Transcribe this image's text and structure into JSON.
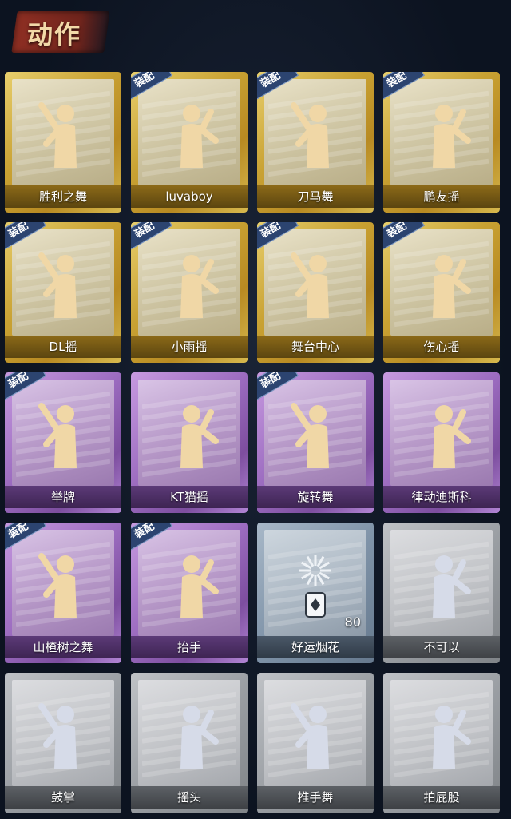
{
  "header": {
    "title": "动作"
  },
  "equipped_tag": "装配",
  "cards": [
    {
      "label": "胜利之舞",
      "rarity": "gold",
      "equipped": false
    },
    {
      "label": "luvaboy",
      "rarity": "gold",
      "equipped": true
    },
    {
      "label": "刀马舞",
      "rarity": "gold",
      "equipped": true
    },
    {
      "label": "鹏友摇",
      "rarity": "gold",
      "equipped": true
    },
    {
      "label": "DL摇",
      "rarity": "gold",
      "equipped": true
    },
    {
      "label": "小雨摇",
      "rarity": "gold",
      "equipped": true
    },
    {
      "label": "舞台中心",
      "rarity": "gold",
      "equipped": true
    },
    {
      "label": "伤心摇",
      "rarity": "gold",
      "equipped": true
    },
    {
      "label": "举牌",
      "rarity": "purple",
      "equipped": true
    },
    {
      "label": "KT猫摇",
      "rarity": "purple",
      "equipped": false
    },
    {
      "label": "旋转舞",
      "rarity": "purple",
      "equipped": true
    },
    {
      "label": "律动迪斯科",
      "rarity": "purple",
      "equipped": false
    },
    {
      "label": "山楂树之舞",
      "rarity": "purple",
      "equipped": true
    },
    {
      "label": "抬手",
      "rarity": "purple",
      "equipped": true
    },
    {
      "label": "好运烟花",
      "rarity": "blue",
      "equipped": false,
      "count": "80"
    },
    {
      "label": "不可以",
      "rarity": "grey",
      "equipped": false
    },
    {
      "label": "鼓掌",
      "rarity": "grey",
      "equipped": false
    },
    {
      "label": "摇头",
      "rarity": "grey",
      "equipped": false
    },
    {
      "label": "推手舞",
      "rarity": "grey",
      "equipped": false
    },
    {
      "label": "拍屁股",
      "rarity": "grey",
      "equipped": false
    }
  ],
  "colors": {
    "gold": "#c9a233",
    "purple": "#9c6cc0",
    "blue": "#7f93a8",
    "grey": "#9a9ea3",
    "tag": "#2c4470"
  }
}
